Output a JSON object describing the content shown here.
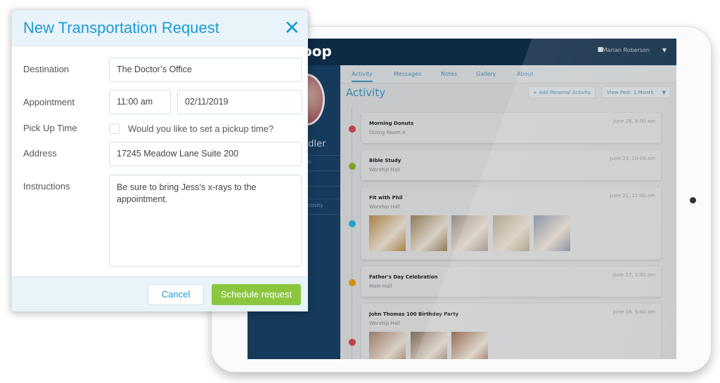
{
  "app": {
    "logo": "oop",
    "user_name": "Marian Roberson",
    "profile_name_partial": "ndler",
    "side_items": [
      "n",
      "ctivity"
    ]
  },
  "tabs": [
    {
      "label": "Activity",
      "active": true
    },
    {
      "label": "Messages"
    },
    {
      "label": "Notes"
    },
    {
      "label": "Gallery"
    },
    {
      "label": "About"
    }
  ],
  "activity": {
    "title": "Activity",
    "add_label": "Add Personal Activity",
    "view_past": "View Past: 1 Month",
    "items": [
      {
        "title": "Morning Donuts",
        "location": "Dining Room A",
        "date": "June 28, 8:00 am",
        "color": "#c0404a",
        "photos": 0
      },
      {
        "title": "Bible Study",
        "location": "Worship Hall",
        "date": "June 23, 10:00 am",
        "color": "#7fa320",
        "photos": 0
      },
      {
        "title": "Fit with Phil",
        "location": "Worship Hall",
        "date": "June 21, 11:00 am",
        "color": "#1fa5c4",
        "photos": 5
      },
      {
        "title": "Father's Day Celebration",
        "location": "Main Hall",
        "date": "June 17, 1:00 pm",
        "color": "#d08f10",
        "photos": 0
      },
      {
        "title": "John Thomas 100 Birthday Party",
        "location": "Worship Hall",
        "date": "June 16, 5:00 am",
        "color": "#c0404a",
        "photos": 3
      }
    ]
  },
  "modal": {
    "title": "New Transportation Request",
    "destination_label": "Destination",
    "destination": "The Doctor’s Office",
    "appointment_label": "Appointment",
    "time": "11:00 am",
    "date": "02/11/2019",
    "pickup_label": "Pick Up Time",
    "pickup_question": "Would you like to set a pickup time?",
    "pickup_checked": false,
    "address_label": "Address",
    "address": "17245 Meadow Lane Suite 200",
    "instructions_label": "Instructions",
    "instructions": "Be sure to bring Jess’s x-rays to the appointment.",
    "cancel": "Cancel",
    "submit": "Schedule request"
  }
}
